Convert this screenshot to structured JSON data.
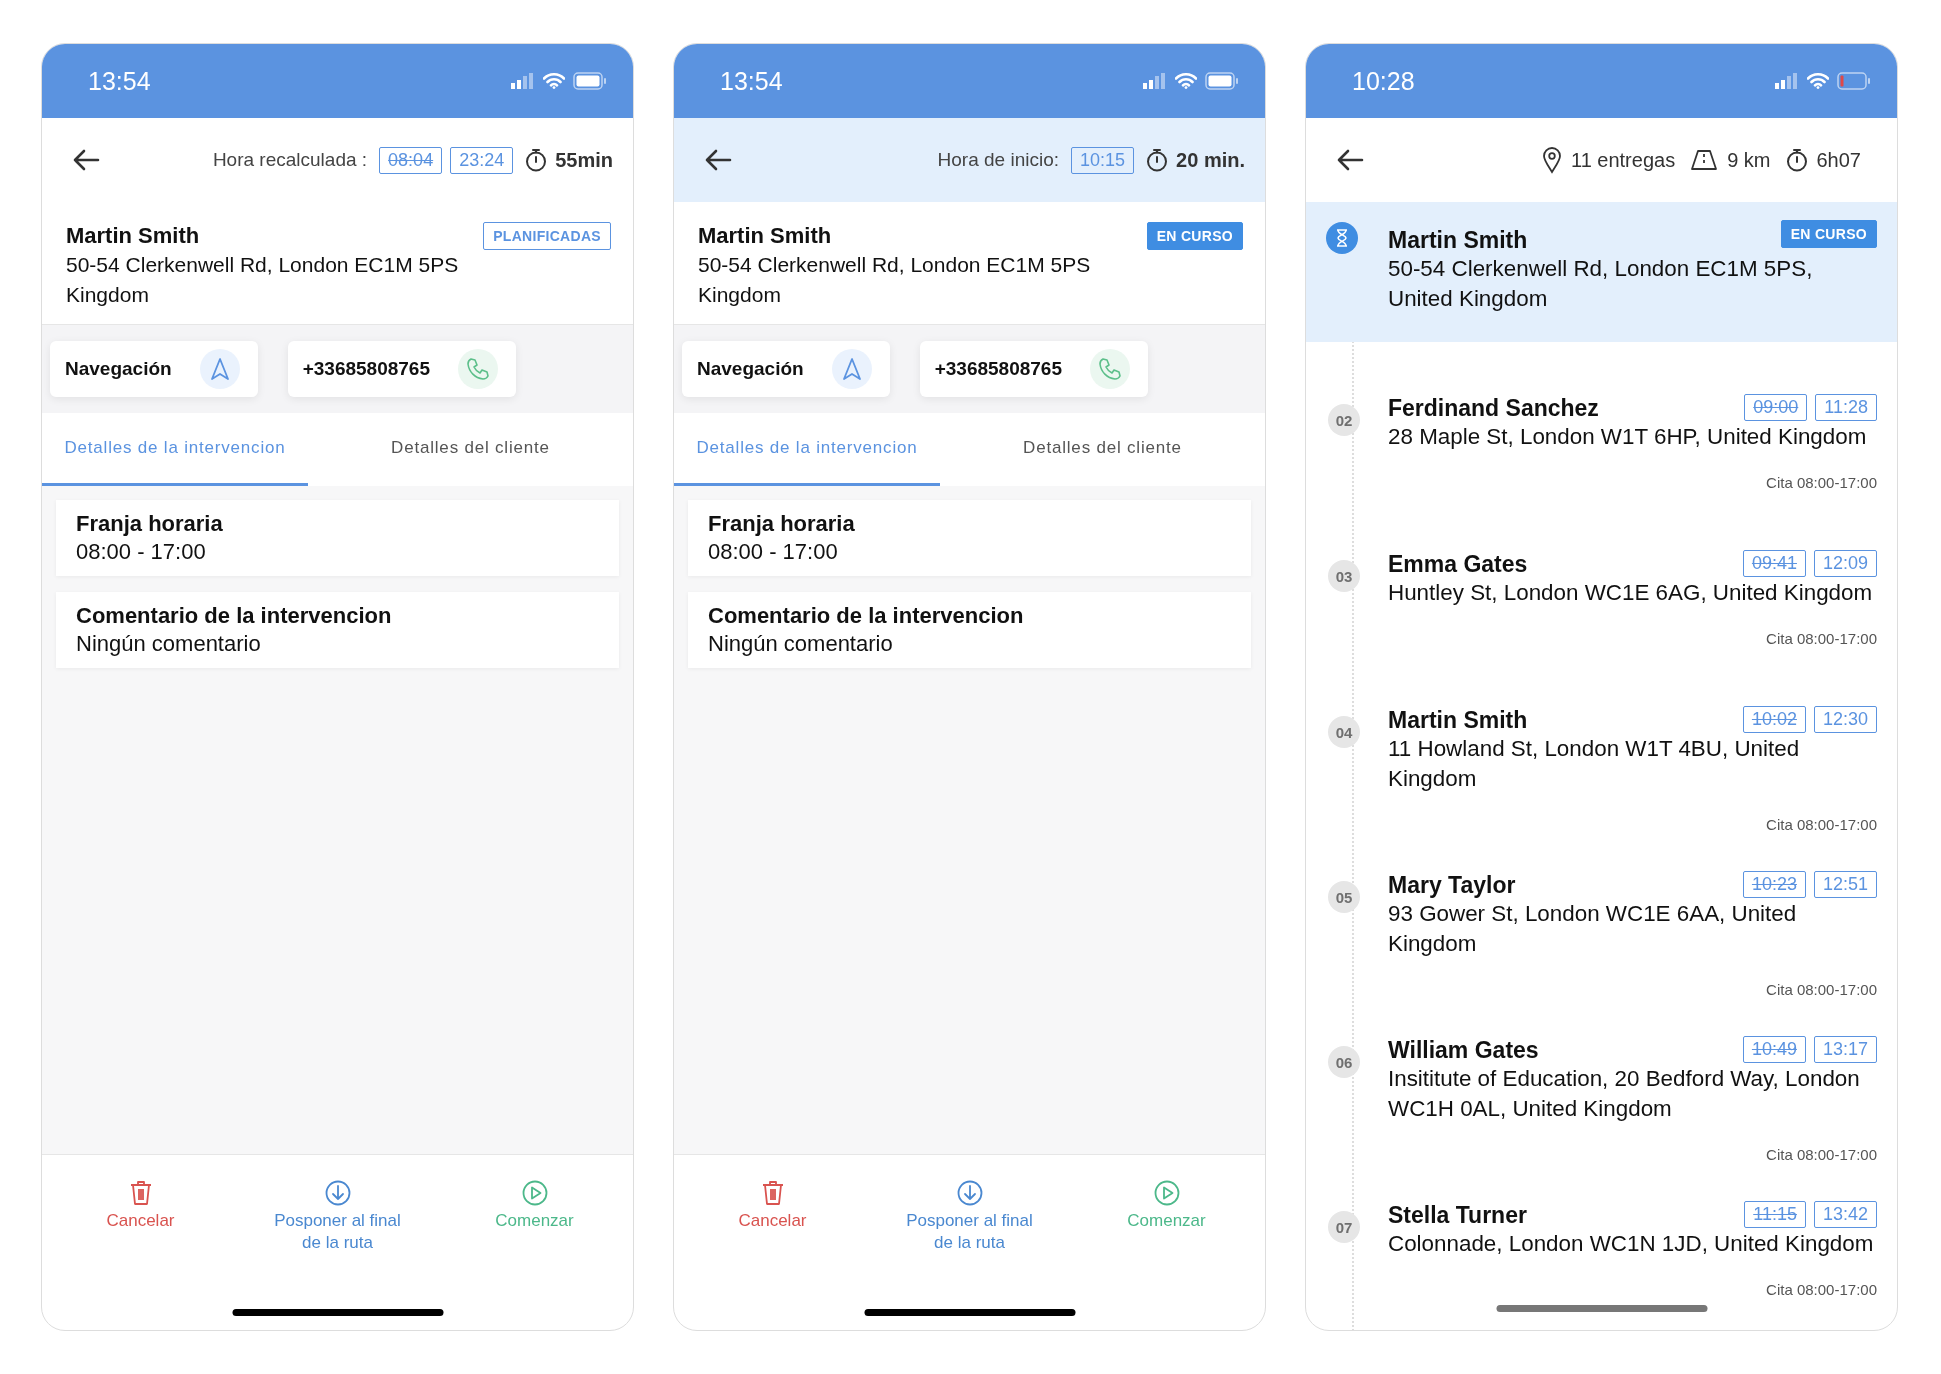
{
  "screens": [
    {
      "kind": "detail",
      "status_bar": {
        "time": "13:54",
        "battery_low": false
      },
      "header": {
        "highlighted": false,
        "label": "Hora recalculada :",
        "times": [
          {
            "text": "08:04",
            "struck": true
          },
          {
            "text": "23:24",
            "struck": false
          }
        ],
        "duration": "55min"
      },
      "customer": {
        "name": "Martin Smith",
        "address_lines": [
          "50-54 Clerkenwell Rd, London EC1M 5PS",
          "Kingdom"
        ],
        "badge": {
          "text": "PLANIFICADAS",
          "filled": false
        }
      },
      "contacts": [
        {
          "kind": "navigation",
          "label": "Navegación"
        },
        {
          "kind": "phone",
          "label": "+33685808765"
        }
      ],
      "tabs": [
        {
          "label": "Detalles de la intervencion",
          "selected": true
        },
        {
          "label": "Detalles del cliente",
          "selected": false
        }
      ],
      "cards": [
        {
          "title": "Franja horaria",
          "value": "08:00 - 17:00"
        },
        {
          "title": "Comentario de la intervencion",
          "value": "Ningún comentario"
        }
      ],
      "actions": [
        {
          "kind": "cancel",
          "label": "Cancelar"
        },
        {
          "kind": "postpone",
          "label": "Posponer al final de la ruta"
        },
        {
          "kind": "start",
          "label": "Comenzar"
        }
      ]
    },
    {
      "kind": "detail",
      "status_bar": {
        "time": "13:54",
        "battery_low": false
      },
      "header": {
        "highlighted": true,
        "label": "Hora de inicio:",
        "times": [
          {
            "text": "10:15",
            "struck": false
          }
        ],
        "duration": "20 min."
      },
      "customer": {
        "name": "Martin Smith",
        "address_lines": [
          "50-54 Clerkenwell Rd, London EC1M 5PS",
          "Kingdom"
        ],
        "badge": {
          "text": "EN CURSO",
          "filled": true
        }
      },
      "contacts": [
        {
          "kind": "navigation",
          "label": "Navegación"
        },
        {
          "kind": "phone",
          "label": "+33685808765"
        }
      ],
      "tabs": [
        {
          "label": "Detalles de la intervencion",
          "selected": true
        },
        {
          "label": "Detalles del cliente",
          "selected": false
        }
      ],
      "cards": [
        {
          "title": "Franja horaria",
          "value": "08:00 - 17:00"
        },
        {
          "title": "Comentario de la intervencion",
          "value": "Ningún comentario"
        }
      ],
      "actions": [
        {
          "kind": "cancel",
          "label": "Cancelar"
        },
        {
          "kind": "postpone",
          "label": "Posponer al final de la ruta"
        },
        {
          "kind": "start",
          "label": "Comenzar"
        }
      ]
    },
    {
      "kind": "route",
      "status_bar": {
        "time": "10:28",
        "battery_low": true
      },
      "stats": [
        {
          "kind": "deliveries",
          "text": "11 entregas"
        },
        {
          "kind": "distance",
          "text": "9 km"
        },
        {
          "kind": "duration",
          "text": "6h07"
        }
      ],
      "stops": [
        {
          "current": true,
          "name": "Martin Smith",
          "address": "50-54 Clerkenwell Rd, London EC1M 5PS, United Kingdom",
          "badge": "EN CURSO"
        },
        {
          "current": false,
          "number": "02",
          "name": "Ferdinand Sanchez",
          "address": "28 Maple St, London W1T 6HP, United Kingdom",
          "times": [
            {
              "text": "09:00",
              "struck": true
            },
            {
              "text": "11:28",
              "struck": false
            }
          ],
          "appointment": "Cita 08:00-17:00"
        },
        {
          "current": false,
          "number": "03",
          "name": "Emma Gates",
          "address": "Huntley St, London WC1E 6AG, United Kingdom",
          "times": [
            {
              "text": "09:41",
              "struck": true
            },
            {
              "text": "12:09",
              "struck": false
            }
          ],
          "appointment": "Cita 08:00-17:00"
        },
        {
          "current": false,
          "number": "04",
          "name": "Martin Smith",
          "address": "11 Howland St, London W1T 4BU, United Kingdom",
          "times": [
            {
              "text": "10:02",
              "struck": true
            },
            {
              "text": "12:30",
              "struck": false
            }
          ],
          "appointment": "Cita 08:00-17:00"
        },
        {
          "current": false,
          "number": "05",
          "name": "Mary Taylor",
          "address": "93 Gower St, London WC1E 6AA, United Kingdom",
          "times": [
            {
              "text": "10:23",
              "struck": true
            },
            {
              "text": "12:51",
              "struck": false
            }
          ],
          "appointment": "Cita 08:00-17:00"
        },
        {
          "current": false,
          "number": "06",
          "name": "William Gates",
          "address": "Insititute of Education, 20 Bedford Way, London WC1H 0AL, United Kingdom",
          "times": [
            {
              "text": "10:49",
              "struck": true
            },
            {
              "text": "13:17",
              "struck": false
            }
          ],
          "appointment": "Cita 08:00-17:00"
        },
        {
          "current": false,
          "number": "07",
          "name": "Stella Turner",
          "address": "Colonnade, London WC1N 1JD, United Kingdom",
          "times": [
            {
              "text": "11:15",
              "struck": true
            },
            {
              "text": "13:42",
              "struck": false
            }
          ],
          "appointment": "Cita 08:00-17:00"
        }
      ]
    }
  ]
}
